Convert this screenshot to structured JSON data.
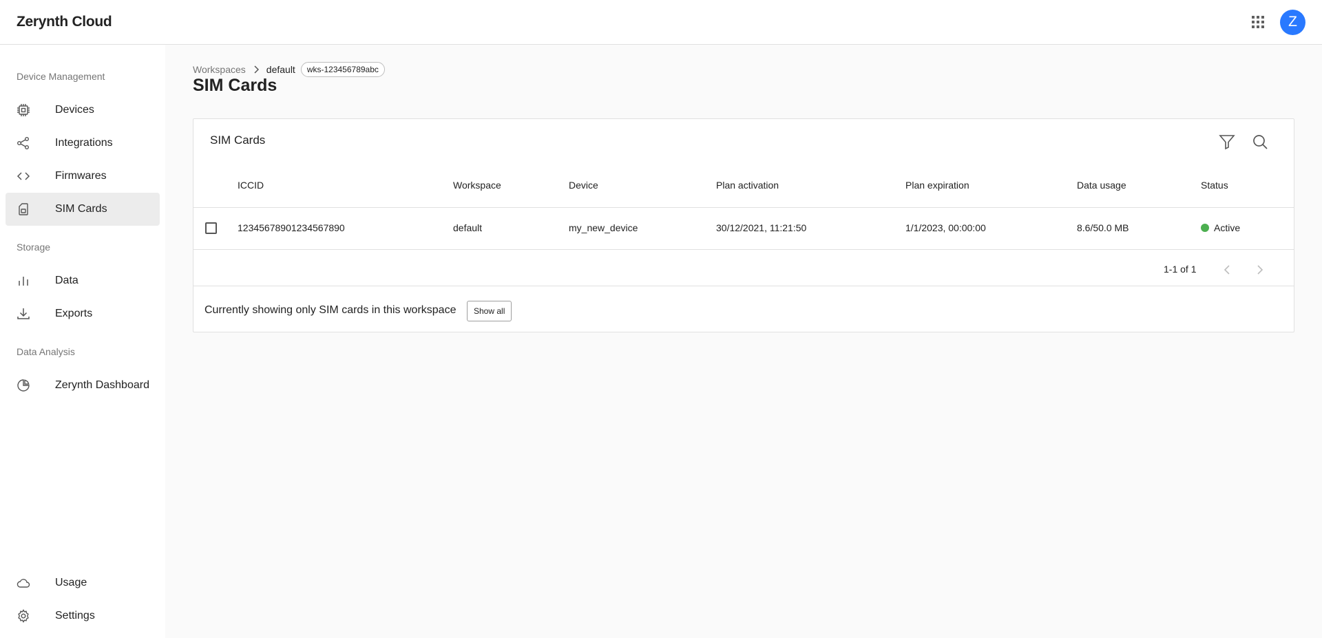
{
  "app": {
    "title": "Zerynth Cloud",
    "avatar_letter": "Z",
    "accent_color": "#2979ff"
  },
  "sidebar": {
    "sections": [
      {
        "title": "Device Management"
      },
      {
        "title": "Storage"
      },
      {
        "title": "Data Analysis"
      }
    ],
    "items": [
      {
        "label": "Devices",
        "icon": "chip-icon"
      },
      {
        "label": "Integrations",
        "icon": "share-icon"
      },
      {
        "label": "Firmwares",
        "icon": "code-icon"
      },
      {
        "label": "SIM Cards",
        "icon": "sim-card-icon",
        "active": true
      },
      {
        "label": "Data",
        "icon": "bar-chart-icon"
      },
      {
        "label": "Exports",
        "icon": "download-icon"
      },
      {
        "label": "Zerynth Dashboard",
        "icon": "pie-chart-icon"
      },
      {
        "label": "Usage",
        "icon": "cloud-icon"
      },
      {
        "label": "Settings",
        "icon": "gear-icon"
      }
    ]
  },
  "breadcrumb": {
    "root": "Workspaces",
    "current": "default",
    "workspace_id": "wks-123456789abc"
  },
  "page": {
    "title": "SIM Cards"
  },
  "card": {
    "title": "SIM Cards",
    "columns": [
      "ICCID",
      "Workspace",
      "Device",
      "Plan activation",
      "Plan expiration",
      "Data usage",
      "Status"
    ],
    "rows": [
      {
        "iccid": "12345678901234567890",
        "workspace": "default",
        "device": "my_new_device",
        "plan_activation": "30/12/2021, 11:21:50",
        "plan_expiration": "1/1/2023, 00:00:00",
        "data_usage": "8.6/50.0 MB",
        "status": "Active",
        "status_color": "#4caf50"
      }
    ],
    "pagination": "1-1 of 1",
    "footer_text": "Currently showing only SIM cards in this workspace",
    "show_all_label": "Show all"
  }
}
